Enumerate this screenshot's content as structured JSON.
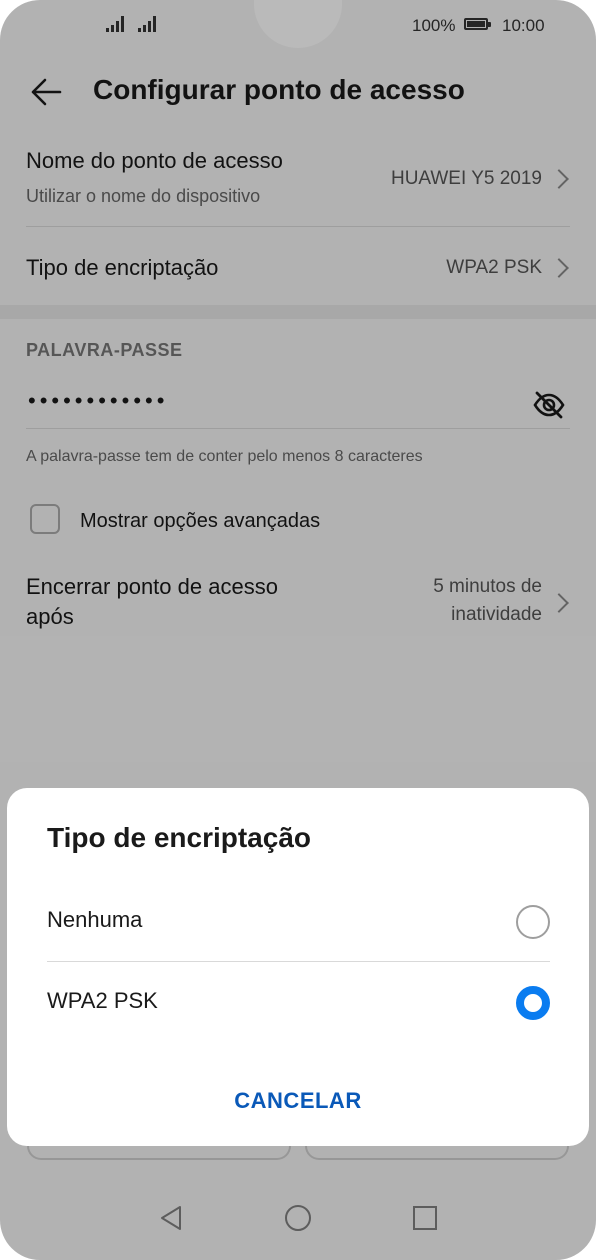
{
  "status_bar": {
    "battery": "100%",
    "time": "10:00"
  },
  "app_bar": {
    "title": "Configurar ponto de acesso"
  },
  "settings": {
    "ap_name": {
      "label": "Nome do ponto de acesso",
      "sub": "Utilizar o nome do dispositivo",
      "value": "HUAWEI Y5 2019"
    },
    "encryption": {
      "label": "Tipo de encriptação",
      "value": "WPA2 PSK"
    },
    "password": {
      "section": "PALAVRA-PASSE",
      "value": "••••••••••••",
      "hint": "A palavra-passe tem de conter pelo menos 8 caracteres"
    },
    "advanced": {
      "label": "Mostrar opções avançadas",
      "checked": false
    },
    "timeout": {
      "label_line1": "Encerrar ponto de acesso",
      "label_line2": "após",
      "value_line1": "5 minutos de",
      "value_line2": "inatividade"
    }
  },
  "dialog": {
    "title": "Tipo de encriptação",
    "options": [
      {
        "label": "Nenhuma",
        "selected": false
      },
      {
        "label": "WPA2 PSK",
        "selected": true
      }
    ],
    "cancel": "CANCELAR"
  },
  "colors": {
    "accent": "#0a7cf0",
    "cancel_text": "#0a59b8"
  },
  "icons": {
    "back": "arrow-left-icon",
    "password_toggle": "eye-off-icon",
    "nav": [
      "back-triangle-icon",
      "home-circle-icon",
      "recents-square-icon"
    ]
  }
}
